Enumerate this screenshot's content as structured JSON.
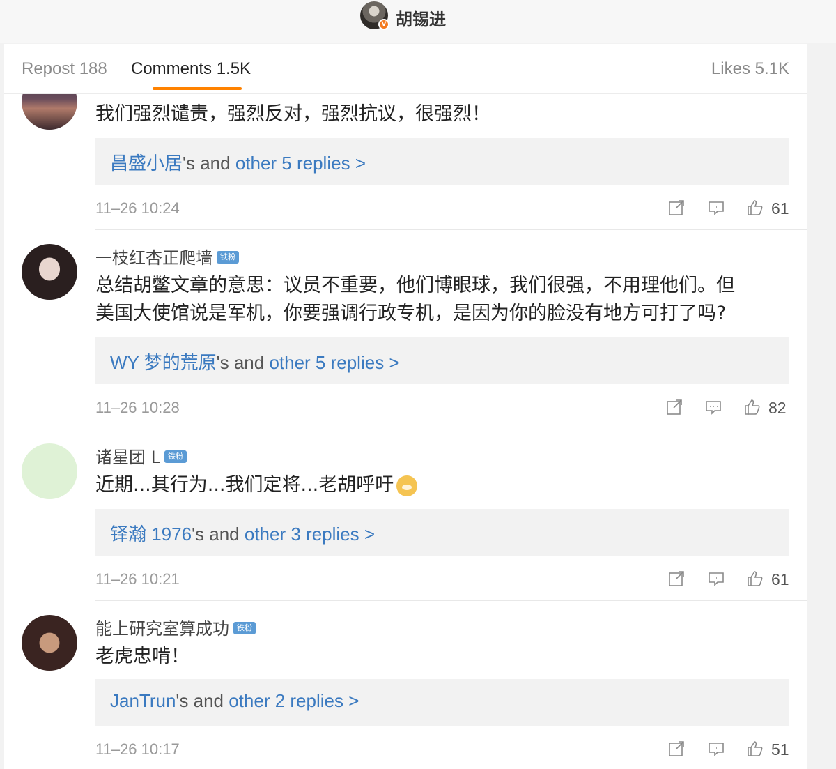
{
  "header": {
    "account_name": "胡锡进",
    "verified_badge": "V"
  },
  "tabs": {
    "repost": "Repost 188",
    "comments": "Comments 1.5K",
    "likes": "Likes 5.1K"
  },
  "comments": [
    {
      "username": "",
      "text": "我们强烈谴责，强烈反对，强烈抗议，很强烈！",
      "replies": {
        "first_user": "昌盛小居",
        "mid": "'s and ",
        "more": "other 5 replies >"
      },
      "time": "11–26 10:24",
      "likes": "61"
    },
    {
      "username": "一枝红杏正爬墙",
      "badge": "铁粉",
      "text_line1": "总结胡鳖文章的意思：议员不重要，他们博眼球，我们很强，不用理他们。但",
      "text_line2": "美国大使馆说是军机，你要强调行政专机，是因为你的脸没有地方可打了吗?",
      "replies": {
        "first_user": "WY 梦的荒原",
        "mid": "'s and ",
        "more": "other 5 replies >"
      },
      "time": "11–26 10:28",
      "likes": "82"
    },
    {
      "username": "诸星团 L",
      "badge": "铁粉",
      "text": "近期...其行为...我们定将...老胡呼吁",
      "emoji": "doge-emoji",
      "replies": {
        "first_user": "铎瀚 1976",
        "mid": "'s and ",
        "more": "other 3 replies >"
      },
      "time": "11–26 10:21",
      "likes": "61"
    },
    {
      "username": "能上研究室算成功",
      "badge": "铁粉",
      "text": "老虎忠啃！",
      "replies": {
        "first_user": "JanTrun",
        "mid": "'s and ",
        "more": "other 2 replies >"
      },
      "time": "11–26 10:17",
      "likes": "51"
    }
  ],
  "icons": {
    "share": "share-icon",
    "comment": "comment-icon",
    "like": "thumbs-up-icon"
  },
  "colors": {
    "accent": "#ff8200",
    "link": "#3b7ac0",
    "badge": "#5b9bd5"
  }
}
